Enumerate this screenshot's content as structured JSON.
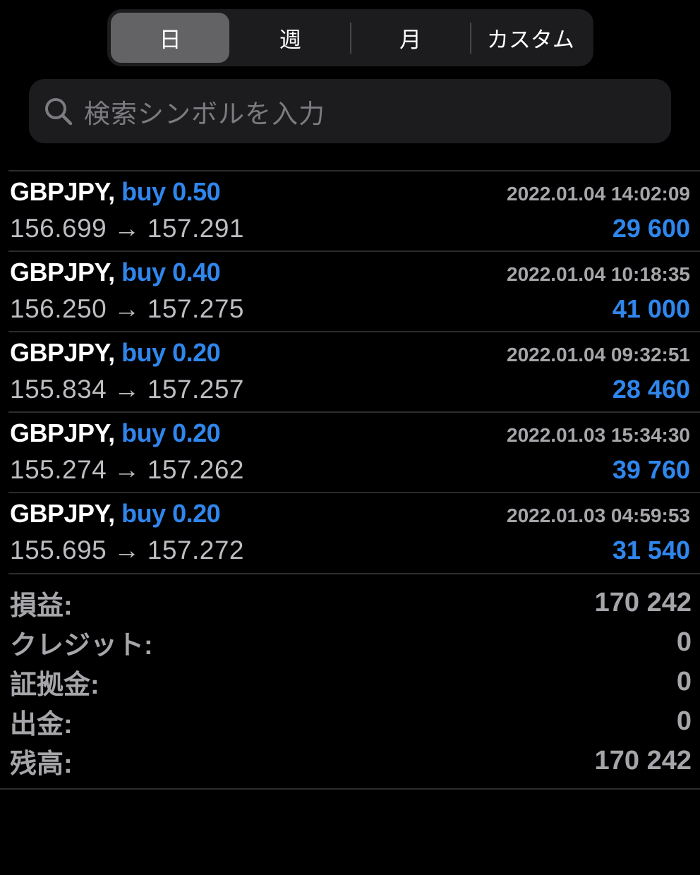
{
  "tabs": [
    {
      "label": "日",
      "active": true
    },
    {
      "label": "週",
      "active": false
    },
    {
      "label": "月",
      "active": false
    },
    {
      "label": "カスタム",
      "active": false
    }
  ],
  "search": {
    "placeholder": "検索シンボルを入力",
    "icon": "search-icon"
  },
  "trades": [
    {
      "symbol": "GBPJPY,",
      "side": "buy 0.50",
      "time": "2022.01.04 14:02:09",
      "open": "156.699",
      "arrow": "→",
      "close": "157.291",
      "profit": "29 600"
    },
    {
      "symbol": "GBPJPY,",
      "side": "buy 0.40",
      "time": "2022.01.04 10:18:35",
      "open": "156.250",
      "arrow": "→",
      "close": "157.275",
      "profit": "41 000"
    },
    {
      "symbol": "GBPJPY,",
      "side": "buy 0.20",
      "time": "2022.01.04 09:32:51",
      "open": "155.834",
      "arrow": "→",
      "close": "157.257",
      "profit": "28 460"
    },
    {
      "symbol": "GBPJPY,",
      "side": "buy 0.20",
      "time": "2022.01.03 15:34:30",
      "open": "155.274",
      "arrow": "→",
      "close": "157.262",
      "profit": "39 760"
    },
    {
      "symbol": "GBPJPY,",
      "side": "buy 0.20",
      "time": "2022.01.03 04:59:53",
      "open": "155.695",
      "arrow": "→",
      "close": "157.272",
      "profit": "31 540"
    }
  ],
  "summary": [
    {
      "label": "損益:",
      "value": "170 242"
    },
    {
      "label": "クレジット:",
      "value": "0"
    },
    {
      "label": "証拠金:",
      "value": "0"
    },
    {
      "label": "出金:",
      "value": "0"
    },
    {
      "label": "残高:",
      "value": "170 242"
    }
  ],
  "colors": {
    "accent": "#2f86ec",
    "background": "#000000",
    "segment_active": "#636366"
  }
}
